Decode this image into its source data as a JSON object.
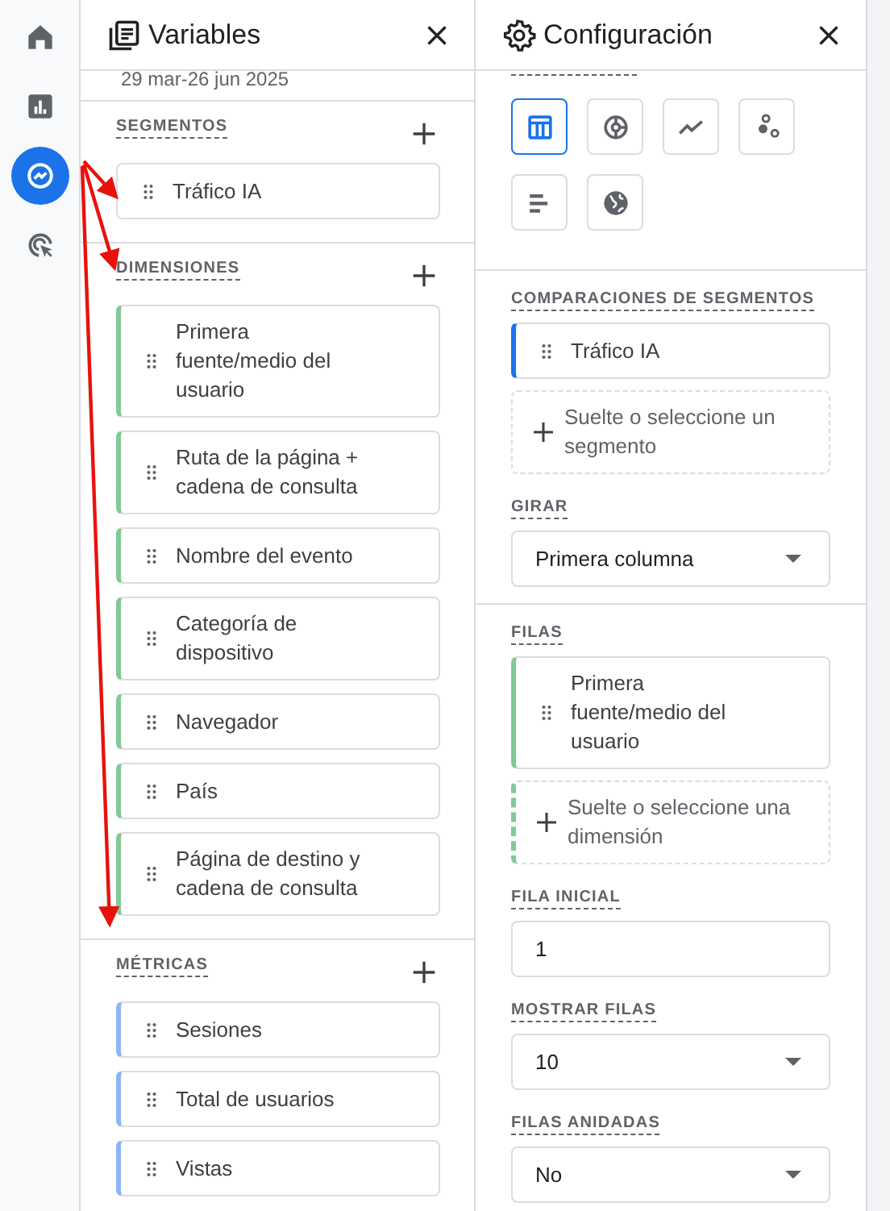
{
  "nav_rail": {
    "items": [
      {
        "kind": "home",
        "selected": false
      },
      {
        "kind": "reports",
        "selected": false
      },
      {
        "kind": "explore",
        "selected": true
      },
      {
        "kind": "advertising",
        "selected": false
      }
    ]
  },
  "variables_panel": {
    "title": "Variables",
    "date_range": "29 mar-26 jun 2025",
    "sections": [
      {
        "heading": "SEGMENTOS",
        "kind": "segment",
        "items": [
          {
            "label": "Tráfico IA"
          }
        ]
      },
      {
        "heading": "DIMENSIONES",
        "kind": "dimension",
        "items": [
          {
            "label": "Primera fuente/medio del usuario"
          },
          {
            "label": "Ruta de la página + cadena de consulta"
          },
          {
            "label": "Nombre del evento"
          },
          {
            "label": "Categoría de dispositivo"
          },
          {
            "label": "Navegador"
          },
          {
            "label": "País"
          },
          {
            "label": "Página de destino y cadena de consulta"
          }
        ]
      },
      {
        "heading": "MÉTRICAS",
        "kind": "metric",
        "items": [
          {
            "label": "Sesiones"
          },
          {
            "label": "Total de usuarios"
          },
          {
            "label": "Vistas"
          }
        ]
      }
    ]
  },
  "settings_panel": {
    "title": "Configuración",
    "chart_types": [
      {
        "kind": "table",
        "selected": true
      },
      {
        "kind": "donut",
        "selected": false
      },
      {
        "kind": "line",
        "selected": false
      },
      {
        "kind": "scatter",
        "selected": false
      },
      {
        "kind": "bar",
        "selected": false
      },
      {
        "kind": "geo",
        "selected": false
      }
    ],
    "segment_comparisons": {
      "heading": "COMPARACIONES DE SEGMENTOS",
      "items": [
        {
          "label": "Tráfico IA"
        }
      ],
      "drop_hint": "Suelte o seleccione un segmento"
    },
    "pivot": {
      "heading": "GIRAR",
      "value": "Primera columna"
    },
    "rows": {
      "heading": "FILAS",
      "items": [
        {
          "label": "Primera fuente/medio del usuario"
        }
      ],
      "drop_hint": "Suelte o seleccione una dimensión"
    },
    "start_row": {
      "heading": "FILA INICIAL",
      "value": "1"
    },
    "show_rows": {
      "heading": "MOSTRAR FILAS",
      "value": "10"
    },
    "nested_rows": {
      "heading": "FILAS ANIDADAS",
      "value": "No"
    }
  }
}
